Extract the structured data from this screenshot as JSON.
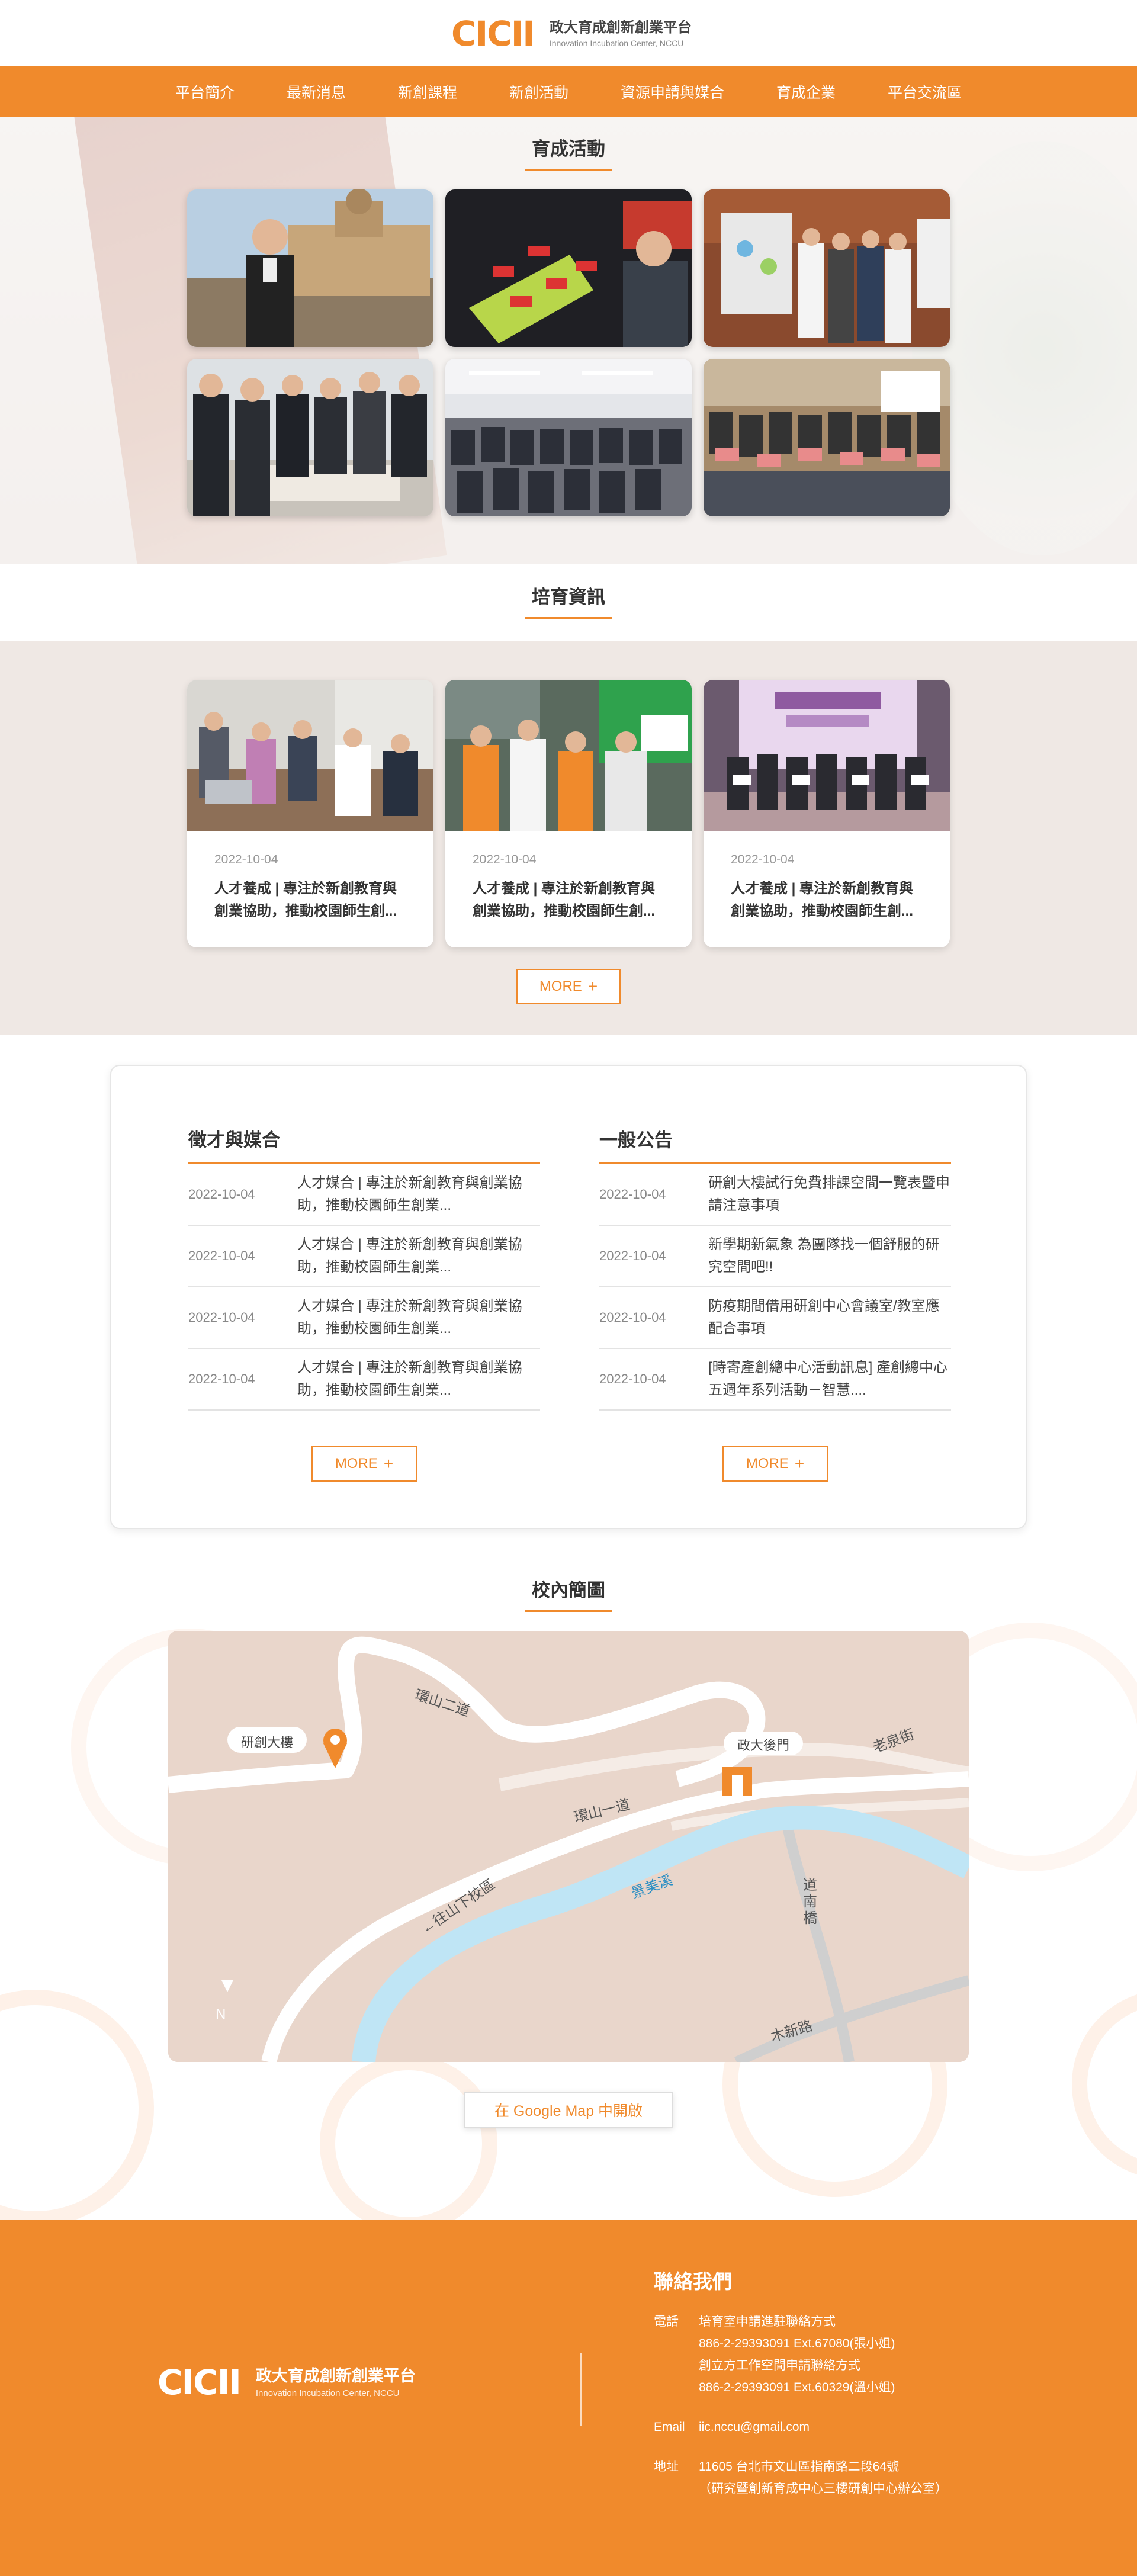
{
  "site": {
    "logo_mark": "CICII",
    "name_zh": "政大育成創新創業平台",
    "name_en": "Innovation Incubation Center, NCCU"
  },
  "nav": {
    "items": [
      "平台簡介",
      "最新消息",
      "新創課程",
      "新創活動",
      "資源申請與媒合",
      "育成企業",
      "平台交流區"
    ]
  },
  "activities": {
    "title": "育成活動"
  },
  "news": {
    "title": "培育資訊",
    "items": [
      {
        "date": "2022-10-04",
        "title": "人才養成 | 專注於新創教育與創業協助，推動校園師生創..."
      },
      {
        "date": "2022-10-04",
        "title": "人才養成 | 專注於新創教育與創業協助，推動校園師生創..."
      },
      {
        "date": "2022-10-04",
        "title": "人才養成 | 專注於新創教育與創業協助，推動校園師生創..."
      }
    ],
    "more": "MORE"
  },
  "recruit": {
    "title": "徵才與媒合",
    "rows": [
      {
        "date": "2022-10-04",
        "text": "人才媒合 | 專注於新創教育與創業協助，推動校園師生創業..."
      },
      {
        "date": "2022-10-04",
        "text": "人才媒合 | 專注於新創教育與創業協助，推動校園師生創業..."
      },
      {
        "date": "2022-10-04",
        "text": "人才媒合 | 專注於新創教育與創業協助，推動校園師生創業..."
      },
      {
        "date": "2022-10-04",
        "text": "人才媒合 | 專注於新創教育與創業協助，推動校園師生創業..."
      }
    ],
    "more": "MORE"
  },
  "notices": {
    "title": "一般公告",
    "rows": [
      {
        "date": "2022-10-04",
        "text": "研創大樓試行免費排課空間一覽表暨申請注意事項"
      },
      {
        "date": "2022-10-04",
        "text": "新學期新氣象 為團隊找一個舒服的研究空間吧!!"
      },
      {
        "date": "2022-10-04",
        "text": "防疫期間借用研創中心會議室/教室應配合事項"
      },
      {
        "date": "2022-10-04",
        "text": "[時寄產創總中心活動訊息] 產創總中心五週年系列活動－智慧...."
      }
    ],
    "more": "MORE"
  },
  "campus_map": {
    "title": "校內簡圖",
    "labels": {
      "building": "研創大樓",
      "gate": "政大後門",
      "road1": "環山二道",
      "road2": "環山一道",
      "road3": "←往山下校區",
      "river": "景美溪",
      "bridge": "道南橋",
      "street1": "老泉街",
      "street2": "木新路",
      "north": "N"
    },
    "gmap_button": "在 Google Map 中開啟"
  },
  "footer": {
    "contact_title": "聯絡我們",
    "phone_label": "電話",
    "phone_lines": [
      "培育室申請進駐聯絡方式",
      "886-2-29393091 Ext.67080(張小姐)",
      "創立方工作空間申請聯絡方式",
      "886-2-29393091 Ext.60329(溫小姐)"
    ],
    "email_label": "Email",
    "email": "iic.nccu@gmail.com",
    "address_label": "地址",
    "address_lines": [
      "11605 台北市文山區指南路二段64號",
      "（研究暨創新育成中心三樓研創中心辦公室）"
    ]
  },
  "colors": {
    "accent": "#f08a2c",
    "map_bg": "#e9d6cb",
    "river": "#bfe5f5"
  }
}
